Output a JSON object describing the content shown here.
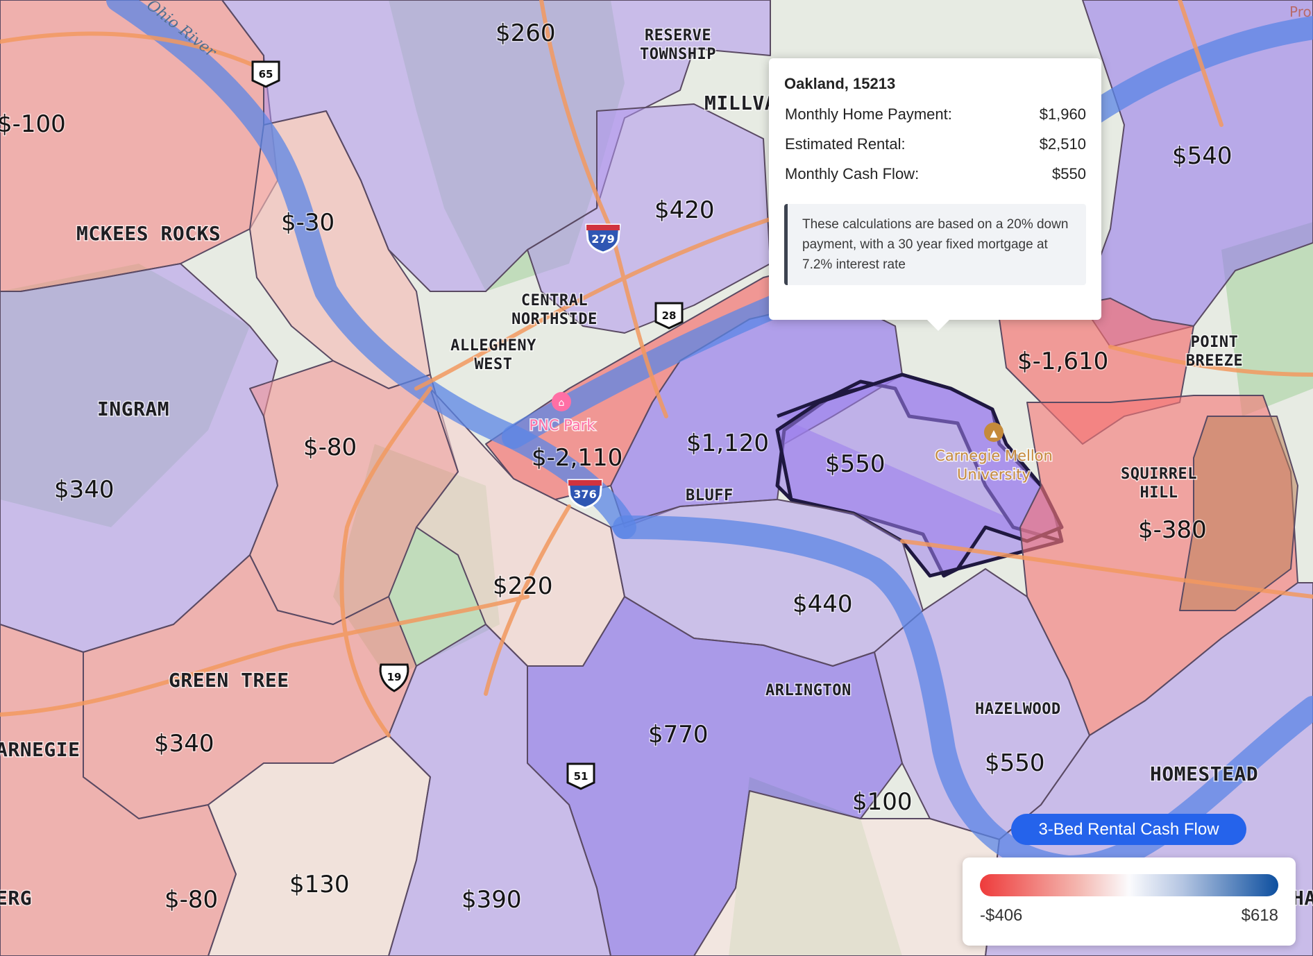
{
  "map": {
    "river_label": "Ohio River",
    "top_right_text": "Pro",
    "region_values": [
      {
        "id": "mckees-rocks-west",
        "value": "$-100"
      },
      {
        "id": "mckees-rocks",
        "value": "$-30"
      },
      {
        "id": "north-hills",
        "value": "$260"
      },
      {
        "id": "north-central",
        "value": "$420"
      },
      {
        "id": "hill-northeast",
        "value": "$540"
      },
      {
        "id": "downtown",
        "value": "$-2,110"
      },
      {
        "id": "hill-district",
        "value": "$1,120"
      },
      {
        "id": "oakland",
        "value": "$550"
      },
      {
        "id": "point-breeze-west",
        "value": "$-1,610"
      },
      {
        "id": "squirrel-hill",
        "value": "$-380"
      },
      {
        "id": "crafton",
        "value": "$-80"
      },
      {
        "id": "ingram",
        "value": "$340"
      },
      {
        "id": "south-hills-north",
        "value": "$220"
      },
      {
        "id": "south-side",
        "value": "$440"
      },
      {
        "id": "arlington",
        "value": "$770"
      },
      {
        "id": "hazelwood",
        "value": "$550"
      },
      {
        "id": "greenfield-south",
        "value": "$100"
      },
      {
        "id": "green-tree",
        "value": "$340"
      },
      {
        "id": "dormont",
        "value": "$130"
      },
      {
        "id": "southwest",
        "value": "$-80"
      },
      {
        "id": "brentwood",
        "value": "$390"
      }
    ],
    "places": [
      {
        "id": "reserve-township",
        "lines": [
          "RESERVE",
          "TOWNSHIP"
        ]
      },
      {
        "id": "millvale",
        "lines": [
          "MILLVA"
        ]
      },
      {
        "id": "mckees-rocks",
        "lines": [
          "MCKEES ROCKS"
        ]
      },
      {
        "id": "central-northside",
        "lines": [
          "CENTRAL",
          "NORTHSIDE"
        ]
      },
      {
        "id": "allegheny-west",
        "lines": [
          "ALLEGHENY",
          "WEST"
        ]
      },
      {
        "id": "ingram",
        "lines": [
          "INGRAM"
        ]
      },
      {
        "id": "bluff",
        "lines": [
          "BLUFF"
        ]
      },
      {
        "id": "point-breeze",
        "lines": [
          "POINT",
          "BREEZE"
        ]
      },
      {
        "id": "squirrel-hill",
        "lines": [
          "SQUIRREL",
          "HILL"
        ]
      },
      {
        "id": "green-tree",
        "lines": [
          "GREEN TREE"
        ]
      },
      {
        "id": "arlington",
        "lines": [
          "ARLINGTON"
        ]
      },
      {
        "id": "hazelwood",
        "lines": [
          "HAZELWOOD"
        ]
      },
      {
        "id": "carnegie",
        "lines": [
          "ARNEGIE"
        ]
      },
      {
        "id": "homestead",
        "lines": [
          "HOMESTEAD"
        ]
      },
      {
        "id": "berg",
        "lines": [
          "ERG"
        ]
      },
      {
        "id": "ha",
        "lines": [
          "HA"
        ]
      }
    ],
    "pois": [
      {
        "id": "pnc-park",
        "lines": [
          "PNC Park"
        ],
        "color": "#ff6fa5"
      },
      {
        "id": "cmu",
        "lines": [
          "Carnegie Mellon",
          "University"
        ],
        "color": "#c58a3b"
      }
    ],
    "shields": [
      {
        "id": "pa-65",
        "label": "65",
        "kind": "state"
      },
      {
        "id": "i-279",
        "label": "279",
        "kind": "interstate"
      },
      {
        "id": "pa-28",
        "label": "28",
        "kind": "state"
      },
      {
        "id": "i-376",
        "label": "376",
        "kind": "interstate"
      },
      {
        "id": "us-19",
        "label": "19",
        "kind": "us"
      },
      {
        "id": "pa-51",
        "label": "51",
        "kind": "state"
      }
    ]
  },
  "popup": {
    "title": "Oakland, 15213",
    "rows": [
      {
        "label": "Monthly Home Payment:",
        "value": "$1,960"
      },
      {
        "label": "Estimated Rental:",
        "value": "$2,510"
      },
      {
        "label": "Monthly Cash Flow:",
        "value": "$550"
      }
    ],
    "note": "These calculations are based on a 20% down payment, with a 30 year fixed mortgage at 7.2% interest rate"
  },
  "legend": {
    "title": "3-Bed Rental Cash Flow",
    "min_label": "-$406",
    "max_label": "$618",
    "colors": {
      "low": "#ee3b3b",
      "mid": "#fbfbfd",
      "high": "#0d4f9f"
    }
  }
}
